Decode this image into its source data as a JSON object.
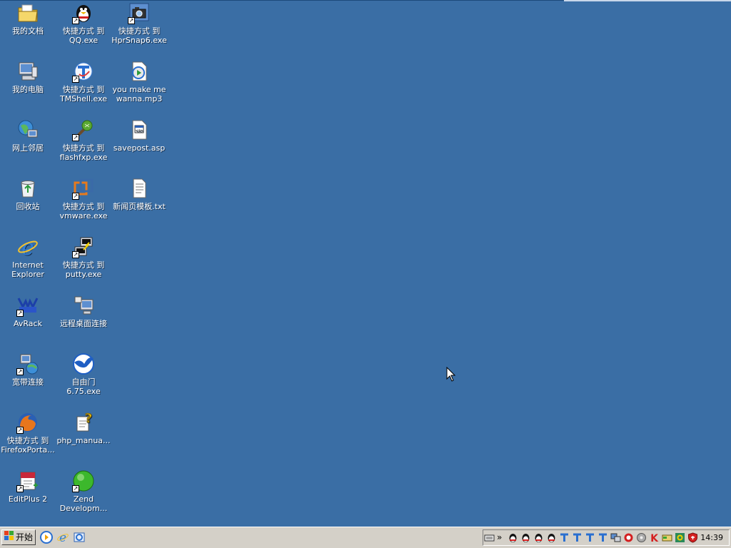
{
  "desktop": {
    "icons": [
      {
        "label": "我的文档",
        "icon": "my-documents-icon",
        "shortcut": false
      },
      {
        "label": "我的电脑",
        "icon": "my-computer-icon",
        "shortcut": false
      },
      {
        "label": "网上邻居",
        "icon": "network-places-icon",
        "shortcut": false
      },
      {
        "label": "回收站",
        "icon": "recycle-bin-icon",
        "shortcut": false
      },
      {
        "label": "Internet Explorer",
        "icon": "internet-explorer-icon",
        "shortcut": false
      },
      {
        "label": "AvRack",
        "icon": "avrack-icon",
        "shortcut": true
      },
      {
        "label": "宽带连接",
        "icon": "broadband-connection-icon",
        "shortcut": true
      },
      {
        "label": "快捷方式 到 FirefoxPorta...",
        "icon": "firefox-icon",
        "shortcut": true
      },
      {
        "label": "EditPlus 2",
        "icon": "editplus-icon",
        "shortcut": true
      },
      {
        "label": "快捷方式 到 QQ.exe",
        "icon": "qq-penguin-icon",
        "shortcut": true
      },
      {
        "label": "快捷方式 到 TMShell.exe",
        "icon": "tmshell-icon",
        "shortcut": true
      },
      {
        "label": "快捷方式 到 flashfxp.exe",
        "icon": "flashfxp-icon",
        "shortcut": true
      },
      {
        "label": "快捷方式 到 vmware.exe",
        "icon": "vmware-icon",
        "shortcut": true
      },
      {
        "label": "快捷方式 到 putty.exe",
        "icon": "putty-icon",
        "shortcut": true
      },
      {
        "label": "远程桌面连接",
        "icon": "remote-desktop-icon",
        "shortcut": false
      },
      {
        "label": "自由门 6.75.exe",
        "icon": "freegate-icon",
        "shortcut": false
      },
      {
        "label": "php_manua...",
        "icon": "help-file-icon",
        "shortcut": false
      },
      {
        "label": "Zend Developm...",
        "icon": "zend-icon",
        "shortcut": true
      },
      {
        "label": "快捷方式 到 HprSnap6.exe",
        "icon": "hypersnap-camera-icon",
        "shortcut": true
      },
      {
        "label": "you make me wanna.mp3",
        "icon": "media-player-file-icon",
        "shortcut": false
      },
      {
        "label": "savepost.asp",
        "icon": "asp-file-icon",
        "shortcut": false
      },
      {
        "label": "新闻页模板.txt",
        "icon": "text-file-icon",
        "shortcut": false
      }
    ]
  },
  "taskbar": {
    "start_label": "开始",
    "quick_launch": [
      "media-player-icon",
      "internet-explorer-icon",
      "outlook-express-icon"
    ],
    "tray_expand": "»",
    "tray_icons": [
      "keyboard-icon",
      "qq-icon",
      "qq-icon",
      "qq-icon",
      "qq-icon",
      "tm-icon",
      "tm-icon",
      "tm-icon",
      "tm-icon",
      "network-icon",
      "antivirus-icon",
      "disk-icon",
      "kaspersky-k-icon",
      "card-icon",
      "speaker-icon",
      "shield-icon"
    ],
    "clock": "14:39"
  }
}
